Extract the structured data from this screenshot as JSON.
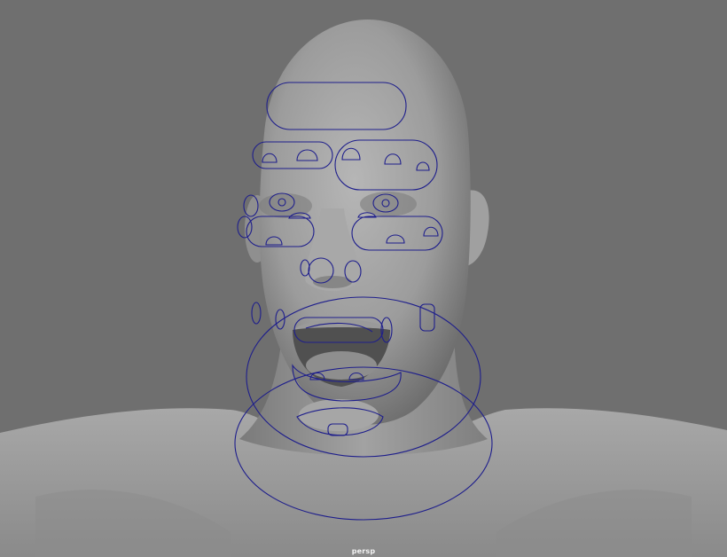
{
  "viewport": {
    "camera": "persp",
    "background_color": "#6f6f6f",
    "model_color": "#a4a4a4",
    "control_curve_color": "#1e1e8c"
  },
  "controls": [
    "forehead-control",
    "brow-control-left",
    "brow-control-right",
    "eye-control-left",
    "eye-control-right",
    "cheek-control-left",
    "cheek-control-right",
    "nose-control",
    "upper-lip-control",
    "lower-lip-control",
    "jaw-control",
    "head-ring-control",
    "neck-ring-control"
  ]
}
